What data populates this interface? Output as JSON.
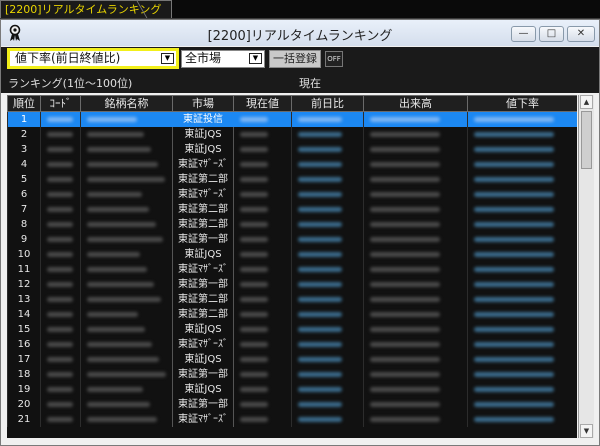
{
  "tab": {
    "label": "[2200]リアルタイムランキング"
  },
  "window": {
    "title": "[2200]リアルタイムランキング",
    "controls": {
      "minimize": "—",
      "maximize": "□",
      "close": "✕"
    }
  },
  "toolbar": {
    "ranking_type": "値下率(前日終値比)",
    "market": "全市場",
    "bulk_register": "一括登録",
    "toggle": "OFF"
  },
  "info": {
    "range_label": "ランキング(1位～100位)",
    "current_label": "現在"
  },
  "columns": [
    "順位",
    "ｺｰﾄﾞ",
    "銘柄名称",
    "市場",
    "現在値",
    "前日比",
    "出来高",
    "値下率"
  ],
  "rows": [
    {
      "rank": "1",
      "market": "東証投信"
    },
    {
      "rank": "2",
      "market": "東証JQS"
    },
    {
      "rank": "3",
      "market": "東証JQS"
    },
    {
      "rank": "4",
      "market": "東証ﾏｻﾞｰｽﾞ"
    },
    {
      "rank": "5",
      "market": "東証第二部"
    },
    {
      "rank": "6",
      "market": "東証ﾏｻﾞｰｽﾞ"
    },
    {
      "rank": "7",
      "market": "東証第二部"
    },
    {
      "rank": "8",
      "market": "東証第二部"
    },
    {
      "rank": "9",
      "market": "東証第一部"
    },
    {
      "rank": "10",
      "market": "東証JQS"
    },
    {
      "rank": "11",
      "market": "東証ﾏｻﾞｰｽﾞ"
    },
    {
      "rank": "12",
      "market": "東証第一部"
    },
    {
      "rank": "13",
      "market": "東証第二部"
    },
    {
      "rank": "14",
      "market": "東証第二部"
    },
    {
      "rank": "15",
      "market": "東証JQS"
    },
    {
      "rank": "16",
      "market": "東証ﾏｻﾞｰｽﾞ"
    },
    {
      "rank": "17",
      "market": "東証JQS"
    },
    {
      "rank": "18",
      "market": "東証第一部"
    },
    {
      "rank": "19",
      "market": "東証JQS"
    },
    {
      "rank": "20",
      "market": "東証第一部"
    },
    {
      "rank": "21",
      "market": "東証ﾏｻﾞｰｽﾞ"
    }
  ],
  "colors": {
    "highlight": "#1c88f2",
    "focus_border": "#f2ef1a",
    "tab_text": "#e8d400"
  },
  "icons": {
    "app": "award-ribbon-icon",
    "dropdown": "chevron-down-icon"
  }
}
